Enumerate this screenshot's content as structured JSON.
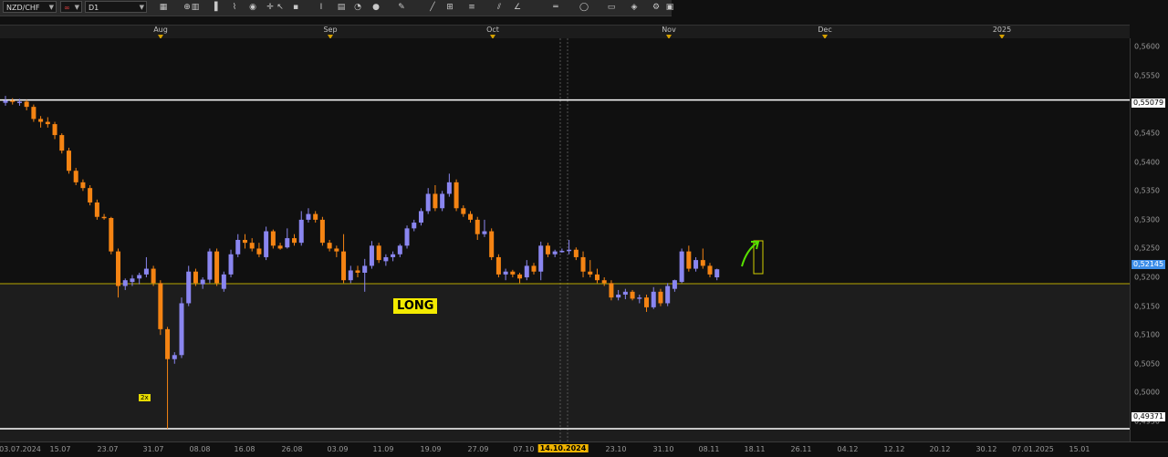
{
  "toolbar": {
    "symbol": "NZD/CHF",
    "timeframe": "D1",
    "icons": [
      "chart-type-icon",
      "link-icon",
      "template-icon",
      "candlestick-icon",
      "indicator-icon",
      "zoom-icon",
      "crosshair-icon",
      "cursor-icon",
      "point-icon",
      "text-icon",
      "comment-icon",
      "clock-icon",
      "globe-icon",
      "pencil-icon",
      "trendline-icon",
      "grid-icon",
      "fibonacci-icon",
      "channel-icon",
      "angle-icon",
      "horizontal-line-icon",
      "circle-icon",
      "shapes-icon",
      "eraser-icon",
      "settings-icon",
      "window-icon"
    ]
  },
  "colors": {
    "bull": "#8a86f0",
    "bear": "#f58413",
    "level": "#ffffff",
    "support": "#b8a800",
    "arrow": "#58e000",
    "box": "#d2d000",
    "zone": "#1d1d1d",
    "background": "#101010",
    "current_price_bg": "#3e8ee8"
  },
  "top_axis": {
    "months": [
      "Aug",
      "Sep",
      "Oct",
      "Nov",
      "Dec",
      "2025"
    ]
  },
  "price_axis": {
    "ticks": [
      "0,5600",
      "0,5550",
      "0,5450",
      "0,5400",
      "0,5350",
      "0,5300",
      "0,5250",
      "0,5200",
      "0,5150",
      "0,5100",
      "0,5050",
      "0,5000",
      "0,4950"
    ],
    "upper_level_label": "0,55079",
    "current_price_label": "0,52145",
    "lower_level_label": "0,49371"
  },
  "date_axis": {
    "ticks": [
      "03.07.2024",
      "15.07",
      "23.07",
      "31.07",
      "08.08",
      "16.08",
      "26.08",
      "03.09",
      "11.09",
      "19.09",
      "27.09",
      "07.10",
      "23.10",
      "31.10",
      "08.11",
      "18.11",
      "26.11",
      "04.12",
      "12.12",
      "20.12",
      "30.12",
      "07.01.2025",
      "15.01"
    ],
    "highlight": "14.10.2024"
  },
  "annotations": {
    "long": "LONG",
    "multiplier": "2x"
  },
  "chart_data": {
    "type": "candlestick",
    "symbol": "NZD/CHF",
    "timeframe": "D1",
    "y_range": [
      0.4915,
      0.5615
    ],
    "levels": {
      "upper": 0.55079,
      "support": 0.5189,
      "lower": 0.49371,
      "current": 0.52145
    },
    "candles": [
      [
        "2024-07-03",
        0.5503,
        0.5515,
        0.5498,
        0.5507
      ],
      [
        "2024-07-04",
        0.5507,
        0.5511,
        0.55,
        0.5505
      ],
      [
        "2024-07-05",
        0.5505,
        0.551,
        0.5498,
        0.5505
      ],
      [
        "2024-07-08",
        0.5505,
        0.5508,
        0.549,
        0.5496
      ],
      [
        "2024-07-09",
        0.5496,
        0.55,
        0.547,
        0.5475
      ],
      [
        "2024-07-10",
        0.5475,
        0.548,
        0.546,
        0.547
      ],
      [
        "2024-07-11",
        0.547,
        0.5478,
        0.546,
        0.5466
      ],
      [
        "2024-07-12",
        0.5466,
        0.547,
        0.544,
        0.5447
      ],
      [
        "2024-07-15",
        0.5447,
        0.545,
        0.5415,
        0.542
      ],
      [
        "2024-07-16",
        0.542,
        0.5425,
        0.538,
        0.5385
      ],
      [
        "2024-07-17",
        0.5385,
        0.539,
        0.536,
        0.5365
      ],
      [
        "2024-07-18",
        0.5365,
        0.537,
        0.535,
        0.5355
      ],
      [
        "2024-07-19",
        0.5355,
        0.536,
        0.5325,
        0.533
      ],
      [
        "2024-07-22",
        0.533,
        0.5335,
        0.53,
        0.5305
      ],
      [
        "2024-07-23",
        0.5305,
        0.531,
        0.53,
        0.5303
      ],
      [
        "2024-07-24",
        0.5303,
        0.5305,
        0.524,
        0.5245
      ],
      [
        "2024-07-25",
        0.5245,
        0.525,
        0.5165,
        0.5185
      ],
      [
        "2024-07-26",
        0.5185,
        0.5198,
        0.5178,
        0.5195
      ],
      [
        "2024-07-29",
        0.5192,
        0.5204,
        0.5185,
        0.5198
      ],
      [
        "2024-07-30",
        0.5198,
        0.5208,
        0.5188,
        0.5204
      ],
      [
        "2024-07-31",
        0.5205,
        0.5235,
        0.52,
        0.5215
      ],
      [
        "2024-08-01",
        0.5215,
        0.522,
        0.5185,
        0.519
      ],
      [
        "2024-08-02",
        0.519,
        0.5195,
        0.51,
        0.511
      ],
      [
        "2024-08-05",
        0.511,
        0.5114,
        0.4937,
        0.5058
      ],
      [
        "2024-08-06",
        0.5058,
        0.507,
        0.505,
        0.5065
      ],
      [
        "2024-08-07",
        0.5065,
        0.5165,
        0.506,
        0.5155
      ],
      [
        "2024-08-08",
        0.5155,
        0.522,
        0.515,
        0.521
      ],
      [
        "2024-08-09",
        0.521,
        0.5215,
        0.5185,
        0.519
      ],
      [
        "2024-08-12",
        0.5188,
        0.52,
        0.518,
        0.5196
      ],
      [
        "2024-08-13",
        0.5196,
        0.525,
        0.519,
        0.5245
      ],
      [
        "2024-08-14",
        0.5245,
        0.525,
        0.5185,
        0.519
      ],
      [
        "2024-08-15",
        0.518,
        0.521,
        0.5175,
        0.5205
      ],
      [
        "2024-08-16",
        0.5205,
        0.5248,
        0.52,
        0.524
      ],
      [
        "2024-08-19",
        0.524,
        0.5275,
        0.5235,
        0.5265
      ],
      [
        "2024-08-20",
        0.5265,
        0.5275,
        0.525,
        0.526
      ],
      [
        "2024-08-21",
        0.526,
        0.5268,
        0.5245,
        0.525
      ],
      [
        "2024-08-22",
        0.525,
        0.526,
        0.5235,
        0.524
      ],
      [
        "2024-08-23",
        0.5235,
        0.5288,
        0.523,
        0.528
      ],
      [
        "2024-08-26",
        0.528,
        0.5283,
        0.525,
        0.5255
      ],
      [
        "2024-08-27",
        0.5255,
        0.526,
        0.5248,
        0.525
      ],
      [
        "2024-08-28",
        0.5252,
        0.5285,
        0.525,
        0.5268
      ],
      [
        "2024-08-29",
        0.5268,
        0.5275,
        0.5255,
        0.526
      ],
      [
        "2024-08-30",
        0.526,
        0.5315,
        0.5255,
        0.53
      ],
      [
        "2024-09-02",
        0.53,
        0.532,
        0.5295,
        0.531
      ],
      [
        "2024-09-03",
        0.531,
        0.5315,
        0.5295,
        0.53
      ],
      [
        "2024-09-04",
        0.53,
        0.5305,
        0.5255,
        0.526
      ],
      [
        "2024-09-05",
        0.526,
        0.5265,
        0.5245,
        0.525
      ],
      [
        "2024-09-06",
        0.525,
        0.5255,
        0.5235,
        0.5245
      ],
      [
        "2024-09-09",
        0.5245,
        0.5275,
        0.519,
        0.5195
      ],
      [
        "2024-09-10",
        0.5195,
        0.522,
        0.519,
        0.5212
      ],
      [
        "2024-09-11",
        0.5212,
        0.522,
        0.52,
        0.5208
      ],
      [
        "2024-09-12",
        0.5208,
        0.5232,
        0.5175,
        0.522
      ],
      [
        "2024-09-13",
        0.522,
        0.5263,
        0.5215,
        0.5255
      ],
      [
        "2024-09-16",
        0.5255,
        0.526,
        0.5225,
        0.523
      ],
      [
        "2024-09-17",
        0.5228,
        0.524,
        0.522,
        0.5235
      ],
      [
        "2024-09-18",
        0.5235,
        0.5245,
        0.5228,
        0.524
      ],
      [
        "2024-09-19",
        0.524,
        0.5258,
        0.5235,
        0.5255
      ],
      [
        "2024-09-20",
        0.5255,
        0.529,
        0.525,
        0.5285
      ],
      [
        "2024-09-23",
        0.5285,
        0.53,
        0.528,
        0.5295
      ],
      [
        "2024-09-24",
        0.5295,
        0.532,
        0.529,
        0.5315
      ],
      [
        "2024-09-25",
        0.5315,
        0.5355,
        0.531,
        0.5345
      ],
      [
        "2024-09-26",
        0.5345,
        0.536,
        0.5315,
        0.532
      ],
      [
        "2024-09-27",
        0.532,
        0.535,
        0.5315,
        0.5345
      ],
      [
        "2024-09-30",
        0.5345,
        0.538,
        0.534,
        0.5365
      ],
      [
        "2024-10-01",
        0.5365,
        0.537,
        0.5315,
        0.532
      ],
      [
        "2024-10-02",
        0.532,
        0.5325,
        0.5305,
        0.531
      ],
      [
        "2024-10-03",
        0.531,
        0.5315,
        0.5295,
        0.53
      ],
      [
        "2024-10-04",
        0.53,
        0.5305,
        0.5265,
        0.5275
      ],
      [
        "2024-10-07",
        0.5275,
        0.53,
        0.527,
        0.528
      ],
      [
        "2024-10-08",
        0.528,
        0.5285,
        0.523,
        0.5235
      ],
      [
        "2024-10-09",
        0.5235,
        0.524,
        0.52,
        0.5205
      ],
      [
        "2024-10-10",
        0.5205,
        0.5215,
        0.5195,
        0.521
      ],
      [
        "2024-10-11",
        0.521,
        0.5213,
        0.52,
        0.5205
      ],
      [
        "2024-10-14",
        0.5205,
        0.5208,
        0.519,
        0.5198
      ],
      [
        "2024-10-15",
        0.52,
        0.523,
        0.5195,
        0.522
      ],
      [
        "2024-10-16",
        0.522,
        0.5225,
        0.5205,
        0.521
      ],
      [
        "2024-10-17",
        0.521,
        0.5262,
        0.5195,
        0.5255
      ],
      [
        "2024-10-18",
        0.5255,
        0.526,
        0.5235,
        0.524
      ],
      [
        "2024-10-21",
        0.524,
        0.5248,
        0.5235,
        0.5245
      ],
      [
        "2024-10-22",
        0.5245,
        0.525,
        0.5243,
        0.5246
      ],
      [
        "2024-10-23",
        0.5246,
        0.5265,
        0.524,
        0.5248
      ],
      [
        "2024-10-24",
        0.5248,
        0.5252,
        0.523,
        0.5235
      ],
      [
        "2024-10-25",
        0.5235,
        0.5245,
        0.52,
        0.521
      ],
      [
        "2024-10-28",
        0.521,
        0.523,
        0.52,
        0.5205
      ],
      [
        "2024-10-29",
        0.5205,
        0.5215,
        0.519,
        0.5195
      ],
      [
        "2024-10-30",
        0.5195,
        0.52,
        0.5185,
        0.519
      ],
      [
        "2024-10-31",
        0.519,
        0.5195,
        0.516,
        0.5165
      ],
      [
        "2024-11-01",
        0.5165,
        0.5178,
        0.516,
        0.517
      ],
      [
        "2024-11-04",
        0.517,
        0.518,
        0.5162,
        0.5175
      ],
      [
        "2024-11-05",
        0.5175,
        0.5178,
        0.516,
        0.5163
      ],
      [
        "2024-11-06",
        0.5163,
        0.517,
        0.5155,
        0.5165
      ],
      [
        "2024-11-07",
        0.5165,
        0.517,
        0.514,
        0.5148
      ],
      [
        "2024-11-08",
        0.5148,
        0.5183,
        0.5145,
        0.5175
      ],
      [
        "2024-11-11",
        0.5175,
        0.518,
        0.515,
        0.5155
      ],
      [
        "2024-11-12",
        0.5155,
        0.519,
        0.515,
        0.5185
      ],
      [
        "2024-11-13",
        0.518,
        0.5196,
        0.5175,
        0.5195
      ],
      [
        "2024-11-14",
        0.5192,
        0.525,
        0.519,
        0.5245
      ],
      [
        "2024-11-15",
        0.5245,
        0.5255,
        0.521,
        0.5215
      ],
      [
        "2024-11-18",
        0.5215,
        0.5235,
        0.521,
        0.523
      ],
      [
        "2024-11-19",
        0.523,
        0.525,
        0.5215,
        0.522
      ],
      [
        "2024-11-20",
        0.522,
        0.5225,
        0.52,
        0.5205
      ],
      [
        "2024-11-21",
        0.52,
        0.5215,
        0.5195,
        0.5214
      ]
    ]
  }
}
